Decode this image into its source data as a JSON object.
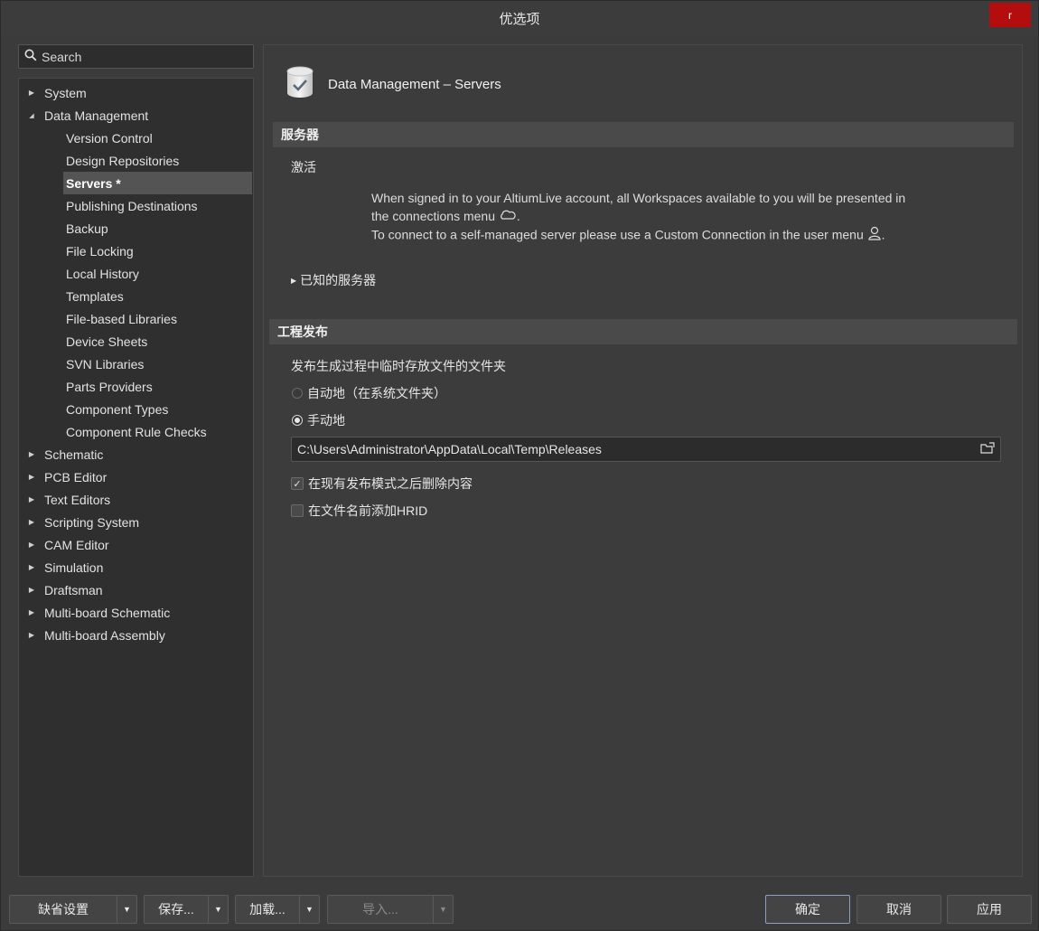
{
  "window": {
    "title": "优选项",
    "close_label": "r"
  },
  "search": {
    "placeholder": "Search"
  },
  "tree": {
    "items": [
      {
        "label": "System",
        "level": 0,
        "expanded": false
      },
      {
        "label": "Data Management",
        "level": 0,
        "expanded": true
      },
      {
        "label": "Version Control",
        "level": 1
      },
      {
        "label": "Design Repositories",
        "level": 1
      },
      {
        "label": "Servers *",
        "level": 1,
        "selected": true
      },
      {
        "label": "Publishing Destinations",
        "level": 1
      },
      {
        "label": "Backup",
        "level": 1
      },
      {
        "label": "File Locking",
        "level": 1
      },
      {
        "label": "Local History",
        "level": 1
      },
      {
        "label": "Templates",
        "level": 1
      },
      {
        "label": "File-based Libraries",
        "level": 1
      },
      {
        "label": "Device Sheets",
        "level": 1
      },
      {
        "label": "SVN Libraries",
        "level": 1
      },
      {
        "label": "Parts Providers",
        "level": 1
      },
      {
        "label": "Component Types",
        "level": 1
      },
      {
        "label": "Component Rule Checks",
        "level": 1
      },
      {
        "label": "Schematic",
        "level": 0,
        "expanded": false
      },
      {
        "label": "PCB Editor",
        "level": 0,
        "expanded": false
      },
      {
        "label": "Text Editors",
        "level": 0,
        "expanded": false
      },
      {
        "label": "Scripting System",
        "level": 0,
        "expanded": false
      },
      {
        "label": "CAM Editor",
        "level": 0,
        "expanded": false
      },
      {
        "label": "Simulation",
        "level": 0,
        "expanded": false
      },
      {
        "label": "Draftsman",
        "level": 0,
        "expanded": false
      },
      {
        "label": "Multi-board Schematic",
        "level": 0,
        "expanded": false
      },
      {
        "label": "Multi-board Assembly",
        "level": 0,
        "expanded": false
      }
    ]
  },
  "page": {
    "title": "Data Management – Servers",
    "servers_section": {
      "title": "服务器",
      "activate_label": "激活",
      "info_line1": "When signed in to your AltiumLive account, all Workspaces available to you will be presented in",
      "info_line2": "the connections menu",
      "info_line3": "To connect to a self-managed server please use a Custom Connection in the user menu",
      "known_servers_label": "已知的服务器"
    },
    "publish_section": {
      "title": "工程发布",
      "folder_label": "发布生成过程中临时存放文件的文件夹",
      "auto_label": "自动地（在系统文件夹）",
      "manual_label": "手动地",
      "selected_option": "manual",
      "path_value": "C:\\Users\\Administrator\\AppData\\Local\\Temp\\Releases",
      "delete_after_label": "在现有发布模式之后删除内容",
      "delete_after_checked": true,
      "hrid_label": "在文件名前添加HRID",
      "hrid_checked": false
    }
  },
  "footer": {
    "defaults_label": "缺省设置",
    "save_label": "保存...",
    "load_label": "加载...",
    "import_label": "导入...",
    "ok_label": "确定",
    "cancel_label": "取消",
    "apply_label": "应用"
  }
}
